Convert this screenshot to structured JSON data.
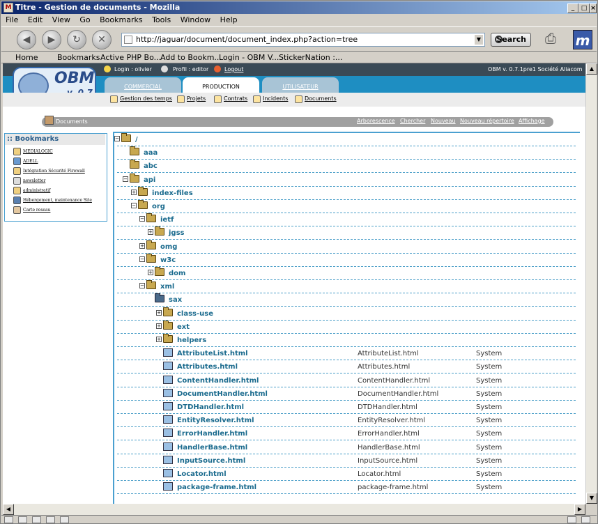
{
  "window": {
    "title": "Titre - Gestion de documents - Mozilla"
  },
  "menu": [
    "File",
    "Edit",
    "View",
    "Go",
    "Bookmarks",
    "Tools",
    "Window",
    "Help"
  ],
  "url": "http://jaguar/document/document_index.php?action=tree",
  "search_label": "Search",
  "toolbar_bookmarks": [
    "Home",
    "Bookmarks",
    "Active PHP Bo...",
    "Add to Bookm...",
    "Login - OBM V...",
    "StickerNation :..."
  ],
  "app": {
    "login": "Login : olivier",
    "profil": "Profil : editor",
    "logout": "Logout",
    "version": "OBM v. 0.7.1pre1  Société Aliacom",
    "logo_name": "OBM",
    "logo_version": "v. 0.7",
    "tabs": [
      "COMMERCIAL",
      "PRODUCTION",
      "UTILISATEUR"
    ],
    "subnav": [
      "Gestion des temps",
      "Projets",
      "Contrats",
      "Incidents",
      "Documents"
    ],
    "section": "Documents",
    "actions": [
      "Arborescence",
      "Chercher",
      "Nouveau",
      "Nouveau répertoire",
      "Affichage"
    ]
  },
  "bookmarks": {
    "title": ":: Bookmarks",
    "items": [
      "MEDIALOGIC",
      "ADELL",
      "Intégration Sécurité Firewall",
      "newsletter",
      "administratif",
      "Hébergement, maintenance Site",
      "Carte reseau"
    ]
  },
  "tree": [
    {
      "name": "/",
      "type": "root"
    },
    {
      "name": "aaa",
      "type": "folder"
    },
    {
      "name": "abc",
      "type": "folder"
    },
    {
      "name": "api",
      "type": "folder-open"
    },
    {
      "name": "index-files",
      "type": "folder-plus"
    },
    {
      "name": "org",
      "type": "folder-open"
    },
    {
      "name": "ietf",
      "type": "folder-open"
    },
    {
      "name": "jgss",
      "type": "folder-plus"
    },
    {
      "name": "omg",
      "type": "folder-plus"
    },
    {
      "name": "w3c",
      "type": "folder-open"
    },
    {
      "name": "dom",
      "type": "folder-plus"
    },
    {
      "name": "xml",
      "type": "folder-open"
    },
    {
      "name": "sax",
      "type": "folder-selected"
    },
    {
      "name": "class-use",
      "type": "folder-plus"
    },
    {
      "name": "ext",
      "type": "folder-plus"
    },
    {
      "name": "helpers",
      "type": "folder-plus"
    },
    {
      "name": "AttributeList.html",
      "type": "file",
      "title": "AttributeList.html",
      "owner": "System"
    },
    {
      "name": "Attributes.html",
      "type": "file",
      "title": "Attributes.html",
      "owner": "System"
    },
    {
      "name": "ContentHandler.html",
      "type": "file",
      "title": "ContentHandler.html",
      "owner": "System"
    },
    {
      "name": "DocumentHandler.html",
      "type": "file",
      "title": "DocumentHandler.html",
      "owner": "System"
    },
    {
      "name": "DTDHandler.html",
      "type": "file",
      "title": "DTDHandler.html",
      "owner": "System"
    },
    {
      "name": "EntityResolver.html",
      "type": "file",
      "title": "EntityResolver.html",
      "owner": "System"
    },
    {
      "name": "ErrorHandler.html",
      "type": "file",
      "title": "ErrorHandler.html",
      "owner": "System"
    },
    {
      "name": "HandlerBase.html",
      "type": "file",
      "title": "HandlerBase.html",
      "owner": "System"
    },
    {
      "name": "InputSource.html",
      "type": "file",
      "title": "InputSource.html",
      "owner": "System"
    },
    {
      "name": "Locator.html",
      "type": "file",
      "title": "Locator.html",
      "owner": "System"
    },
    {
      "name": "package-frame.html",
      "type": "file",
      "title": "package-frame.html",
      "owner": "System"
    }
  ]
}
